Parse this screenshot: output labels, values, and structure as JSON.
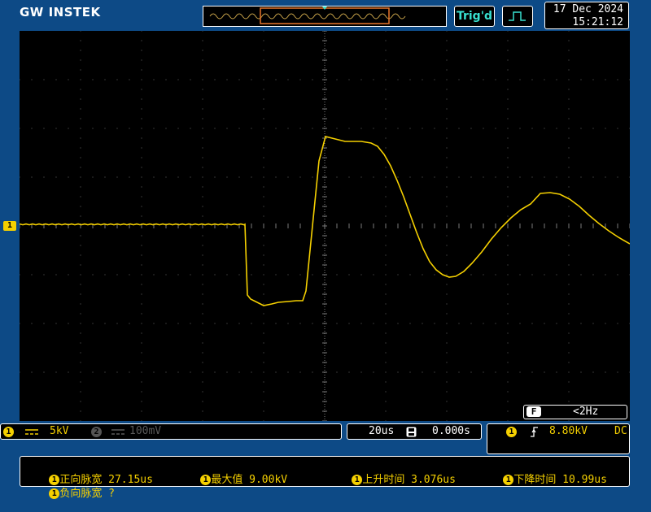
{
  "header": {
    "brand": "GW INSTEK",
    "trigger_status": "Trig'd",
    "trigger_mode_icon": "square-wave-icon",
    "date": "17 Dec 2024",
    "time": "15:21:12"
  },
  "freq_counter": {
    "label": "F",
    "value": "<2Hz"
  },
  "channel1": {
    "number": "1",
    "coupling_icon": "dc-coupling-icon",
    "scale": "5kV",
    "color": "#f5d000"
  },
  "channel2": {
    "number": "2",
    "scale": "100mV"
  },
  "timebase": {
    "scale": "20us",
    "position": "0.000s"
  },
  "trigger": {
    "source": "1",
    "slope_icon": "rising-edge-icon",
    "level": "8.80kV",
    "coupling": "DC"
  },
  "measurements": [
    {
      "source": "1",
      "label": "正向脉宽",
      "value": "27.15us"
    },
    {
      "source": "1",
      "label": "最大值",
      "value": "9.00kV"
    },
    {
      "source": "1",
      "label": "上升时间",
      "value": "3.076us"
    },
    {
      "source": "1",
      "label": "下降时间",
      "value": "10.99us"
    },
    {
      "source": "1",
      "label": "负向脉宽",
      "value": "?"
    }
  ],
  "colors": {
    "background": "#0d4a86",
    "trace": "#f5d000",
    "trigger_marker": "#f5d000",
    "trig_status": "#38e0d0"
  }
}
